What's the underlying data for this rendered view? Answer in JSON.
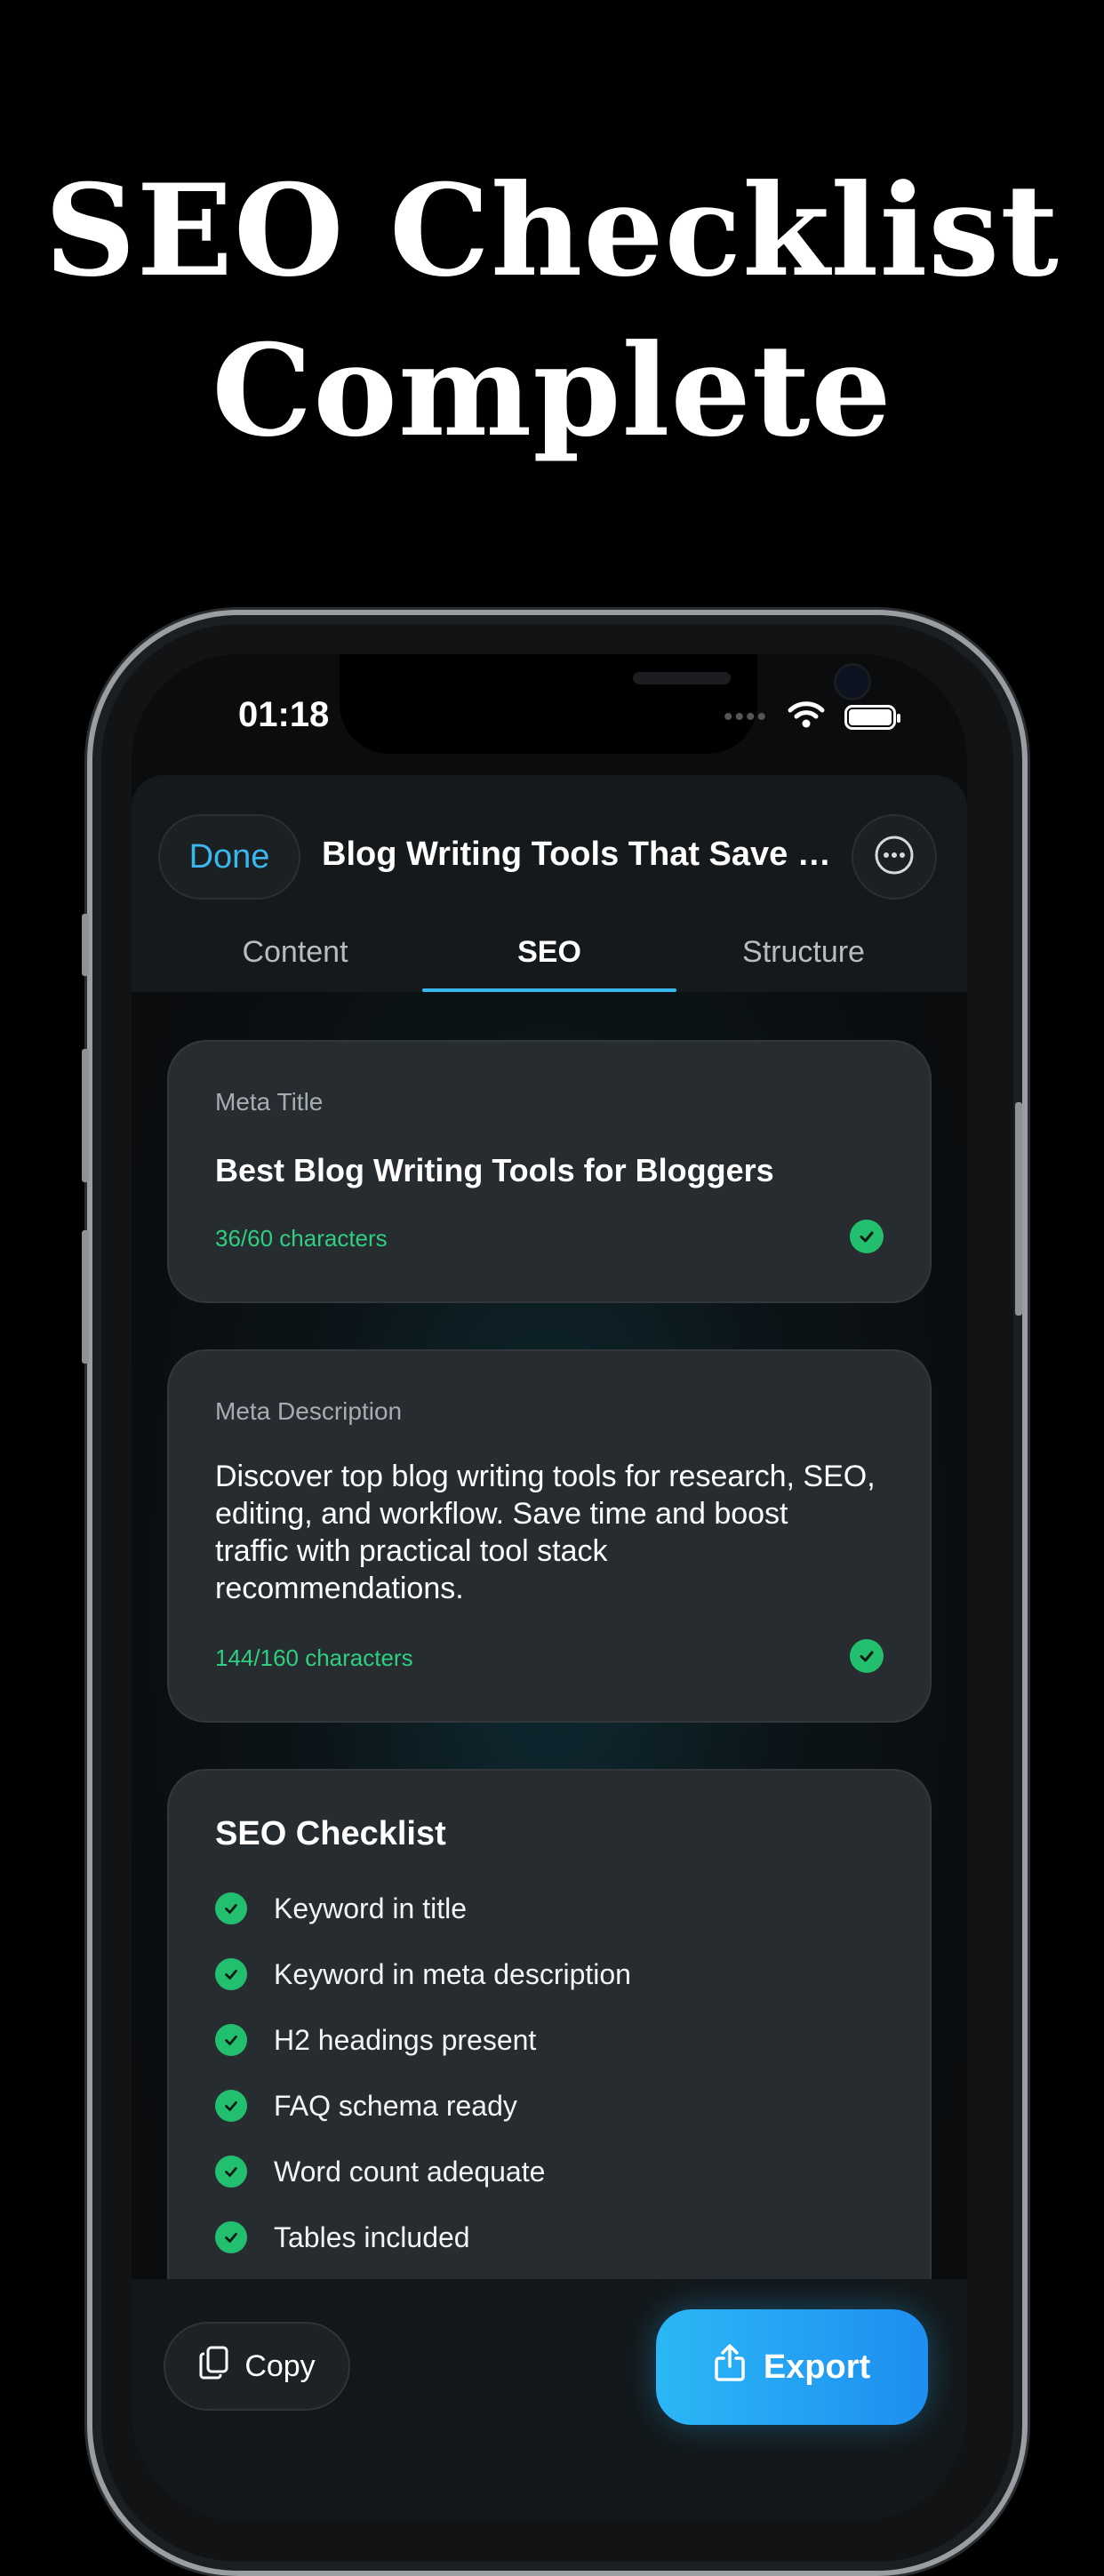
{
  "headline": {
    "line1": "SEO Checklist",
    "line2": "Complete"
  },
  "status_bar": {
    "time": "01:18"
  },
  "header": {
    "done_label": "Done",
    "title": "Blog Writing Tools That Save T..."
  },
  "tabs": [
    {
      "label": "Content",
      "active": false
    },
    {
      "label": "SEO",
      "active": true
    },
    {
      "label": "Structure",
      "active": false
    }
  ],
  "meta_title": {
    "label": "Meta Title",
    "value": "Best Blog Writing Tools for Bloggers",
    "count": "36/60 characters"
  },
  "meta_description": {
    "label": "Meta Description",
    "lines": [
      "Discover top blog writing tools for research, SEO,",
      "editing, and workflow. Save time and boost",
      "traffic with practical tool stack",
      "recommendations."
    ],
    "count": "144/160 characters"
  },
  "seo_checklist": {
    "title": "SEO Checklist",
    "items": [
      "Keyword in title",
      "Keyword in meta description",
      "H2 headings present",
      "FAQ schema ready",
      "Word count adequate",
      "Tables included"
    ]
  },
  "bottom_bar": {
    "copy_label": "Copy",
    "export_label": "Export"
  },
  "colors": {
    "accent": "#3bb7f0",
    "success": "#22c06e",
    "background": "#000000",
    "card": "#272c30"
  }
}
